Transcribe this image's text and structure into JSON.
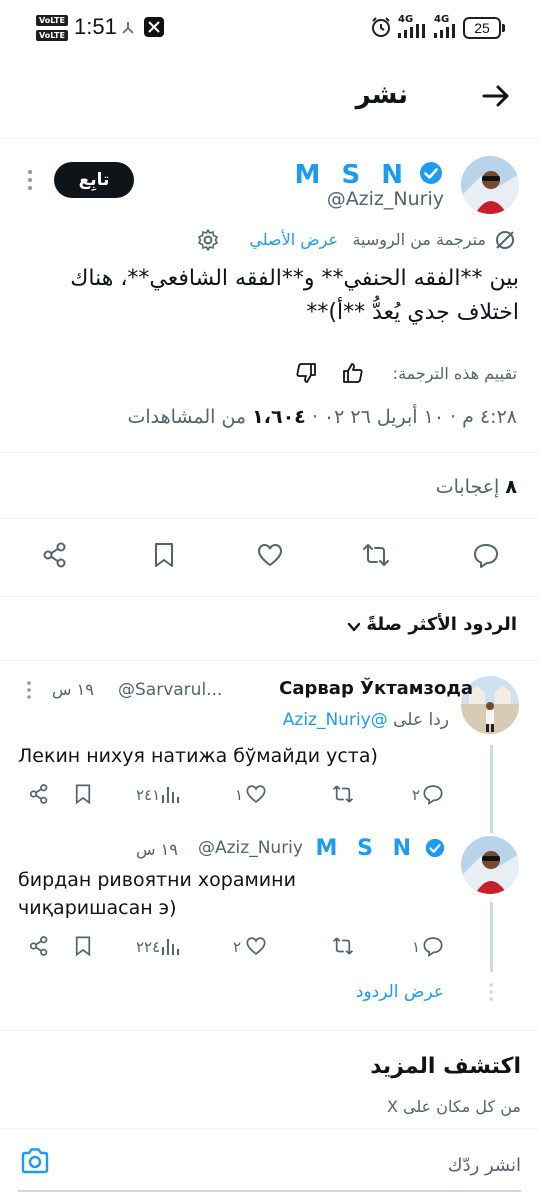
{
  "status_bar": {
    "volte1": "VoLTE 1",
    "volte2": "VoLTE 2",
    "time": "1:51",
    "network1": "4G",
    "network2": "4G",
    "battery": "25",
    "icons": [
      "signal-icon",
      "x-app-icon",
      "alarm-icon",
      "wifi-icon"
    ]
  },
  "header": {
    "title": "نشر",
    "back_icon": "arrow-right-icon"
  },
  "tweet": {
    "author_name": "M S N",
    "author_handle": "@Aziz_Nuriy",
    "follow_label": "تابِع",
    "translated_label": "مترجمة من الروسية",
    "show_original_label": "عرض الأصلي",
    "text": "بين **الفقه الحنفي** و**الفقه الشافعي**، هناك اختلاف جدي يُعدُّ **أ)**",
    "rate_label": "تقييم هذه الترجمة:",
    "meta": "٤:٢٨ م ·١٠ أبريل ٢٦ ٠٢ · ١،٦٠٤ من المشاهدات",
    "time": "٤:٢٨ م",
    "date": "١٠ أبريل ٢٦ ٠٢",
    "views_count": "١،٦٠٤",
    "views_label": "من المشاهدات",
    "likes_count": "٨",
    "likes_label": "إعجابات"
  },
  "sort": {
    "label": "الردود الأكثر صلةً"
  },
  "replies": [
    {
      "author_name": "Сарвар Ўктамзода",
      "author_handle": "@Sarvarul...",
      "time": "١٩ س",
      "replying_to_label": "ردا على",
      "replying_to_handle": "@Aziz_Nuriy",
      "text": "Лекин нихуя натижа бўмайди уста)",
      "replies_count": "٢",
      "likes_count": "١",
      "views_count": "٢٤١"
    },
    {
      "author_name": "M S N",
      "author_handle": "@Aziz_Nuriy",
      "time": "١٩ س",
      "text": "бирдан ривоятни хорамини чиқаришасан э)",
      "replies_count": "١",
      "likes_count": "٢",
      "views_count": "٢٢٤"
    }
  ],
  "show_replies_label": "عرض الردود",
  "discover": {
    "title": "اكتشف المزيد",
    "subtitle": "من كل مكان على X"
  },
  "compose": {
    "placeholder": "انشر ردّك"
  },
  "colors": {
    "accent": "#1d9bf0",
    "text": "#0f1419",
    "muted": "#536471",
    "divider": "#eff3f4"
  }
}
